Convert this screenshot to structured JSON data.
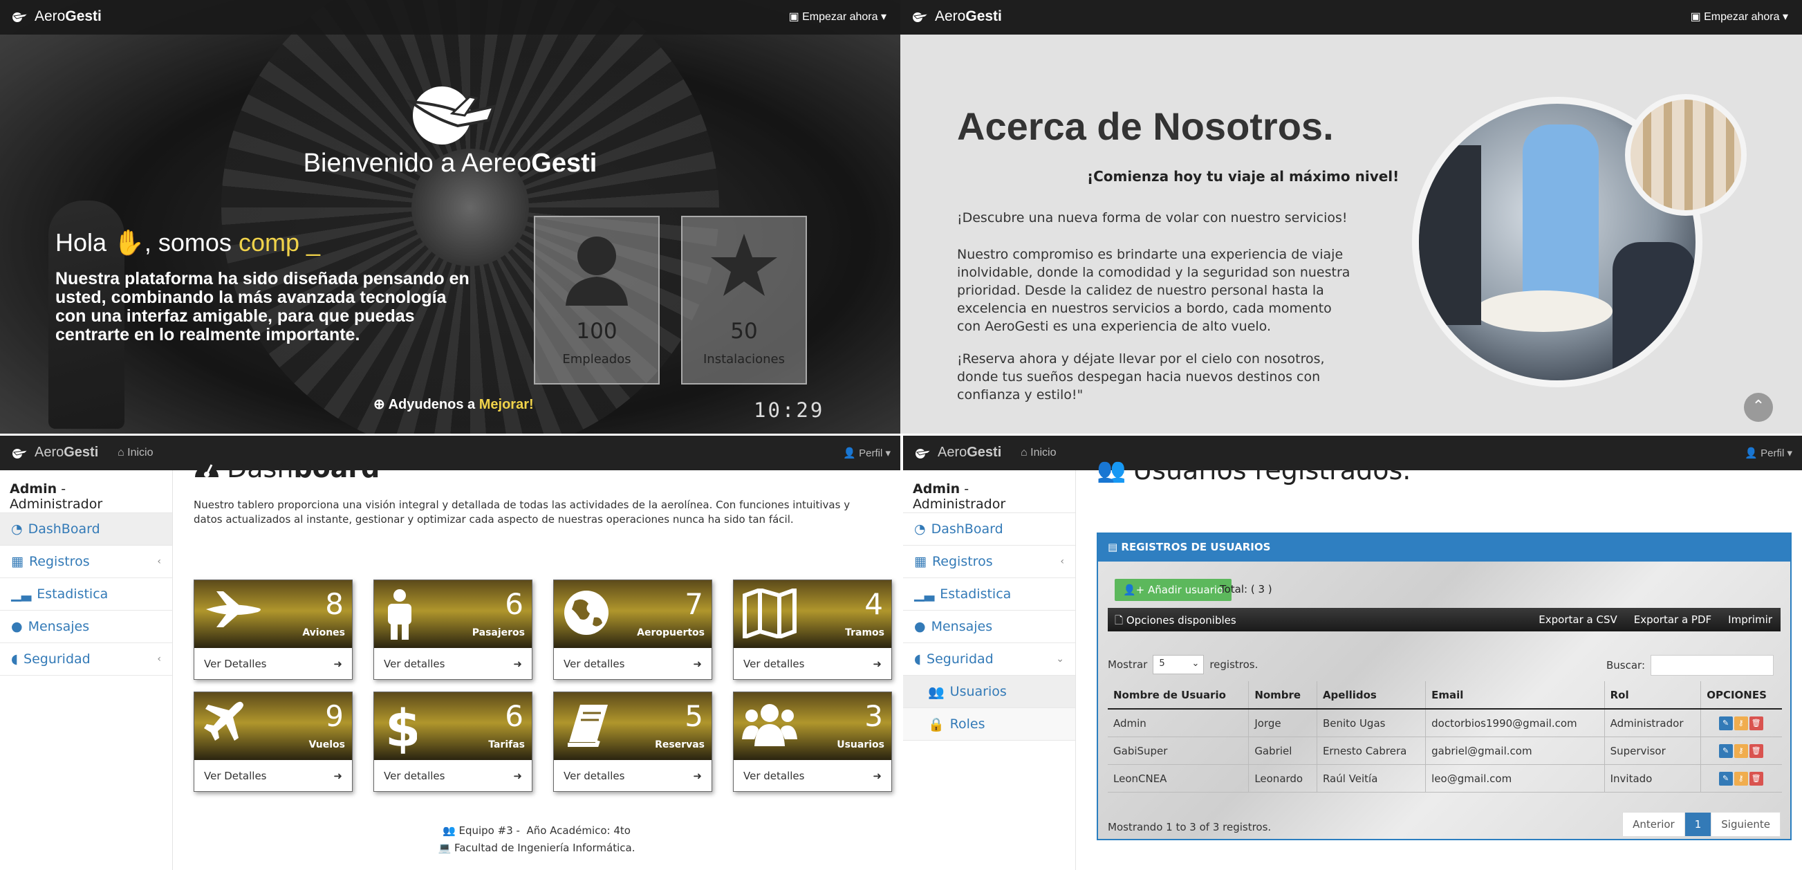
{
  "brand": {
    "prefix": "Aero",
    "bold": "Gesti"
  },
  "hero": {
    "cta": "Empezar ahora",
    "welcome_prefix": "Bienvenido a AereoGesti",
    "hola": "Hola",
    "somos": ", somos",
    "typed": "comp _",
    "description": "Nuestra plataforma ha sido diseñada pensando en usted, combinando la más avanzada tecnología con una interfaz amigable, para que puedas centrarte en lo realmente importante.",
    "stats": [
      {
        "value": "100",
        "label": "Empleados",
        "icon": "user-icon"
      },
      {
        "value": "50",
        "label": "Instalaciones",
        "icon": "star-icon"
      }
    ],
    "help_prefix": "Adyudenos a",
    "help_link": "Mejorar!",
    "clock": "10:29"
  },
  "about": {
    "cta": "Empezar ahora",
    "title": "Acerca de Nosotros.",
    "subtitle": "¡Comienza hoy tu viaje al máximo nivel!",
    "p1": "¡Descubre una nueva forma de volar con nuestro servicios!",
    "p2": "Nuestro compromiso es brindarte una experiencia de viaje inolvidable, donde la comodidad y la seguridad son nuestra prioridad. Desde la calidez de nuestro personal hasta la excelencia en nuestros servicios a bordo, cada momento con AeroGesti es una experiencia de alto vuelo.",
    "p3": "¡Reserva ahora y déjate llevar por el cielo con nosotros, donde tus sueños despegan hacia nuevos destinos con confianza y estilo!\""
  },
  "admin_nav": {
    "home": "Inicio",
    "profile": "Perfil"
  },
  "sidebar": {
    "user": "Admin",
    "role": " - Administrador",
    "items": [
      {
        "label": "DashBoard"
      },
      {
        "label": "Registros"
      },
      {
        "label": "Estadistica"
      },
      {
        "label": "Mensajes"
      },
      {
        "label": "Seguridad"
      }
    ],
    "sub_items": [
      {
        "label": "Usuarios"
      },
      {
        "label": "Roles"
      }
    ]
  },
  "dashboard": {
    "title_a": "Dash",
    "title_b": "board",
    "description": "Nuestro tablero proporciona una visión integral y detallada de todas las actividades de la aerolínea. Con funciones intuitivas y datos actualizados al instante, gestionar y optimizar cada aspecto de nuestras operaciones nunca ha sido tan fácil.",
    "tiles": [
      {
        "value": "8",
        "label": "Aviones",
        "link": "Ver Detalles",
        "icon": "shuttle-icon"
      },
      {
        "value": "6",
        "label": "Pasajeros",
        "link": "Ver detalles",
        "icon": "person-icon"
      },
      {
        "value": "7",
        "label": "Aeropuertos",
        "link": "Ver detalles",
        "icon": "globe-icon"
      },
      {
        "value": "4",
        "label": "Tramos",
        "link": "Ver detalles",
        "icon": "map-icon"
      },
      {
        "value": "9",
        "label": "Vuelos",
        "link": "Ver Detalles",
        "icon": "plane-icon"
      },
      {
        "value": "6",
        "label": "Tarifas",
        "link": "Ver detalles",
        "icon": "dollar-icon"
      },
      {
        "value": "5",
        "label": "Reservas",
        "link": "Ver detalles",
        "icon": "book-icon"
      },
      {
        "value": "3",
        "label": "Usuarios",
        "link": "Ver detalles",
        "icon": "users-icon"
      }
    ],
    "footer1": "Equipo #3 -  Año Académico: 4to",
    "footer2": "Facultad de Ingeniería Informática."
  },
  "users": {
    "title": "Usuarios registrados.",
    "panel_title": "REGISTROS DE USUARIOS",
    "add_button": "Añadir usuario",
    "total": "Total: ( 3 )",
    "options": "Opciones disponibles",
    "export_csv": "Exportar a CSV",
    "export_pdf": "Exportar a PDF",
    "print": "Imprimir",
    "show_prefix": "Mostrar",
    "show_value": "5",
    "show_suffix": "registros.",
    "search_label": "Buscar:",
    "columns": [
      "Nombre de Usuario",
      "Nombre",
      "Apellidos",
      "Email",
      "Rol",
      "OPCIONES"
    ],
    "rows": [
      [
        "Admin",
        "Jorge",
        "Benito Ugas",
        "doctorbios1990@gmail.com",
        "Administrador"
      ],
      [
        "GabiSuper",
        "Gabriel",
        "Ernesto Cabrera",
        "gabriel@gmail.com",
        "Supervisor"
      ],
      [
        "LeonCNEA",
        "Leonardo",
        "Raúl Veitía",
        "leo@gmail.com",
        "Invitado"
      ]
    ],
    "showing": "Mostrando 1 to 3 of 3 registros.",
    "prev": "Anterior",
    "page": "1",
    "next": "Siguiente"
  },
  "colors": {
    "accent": "#f1d34a",
    "primary": "#337ab7",
    "tile_gold": "#b0962c",
    "success": "#5cb85c"
  }
}
